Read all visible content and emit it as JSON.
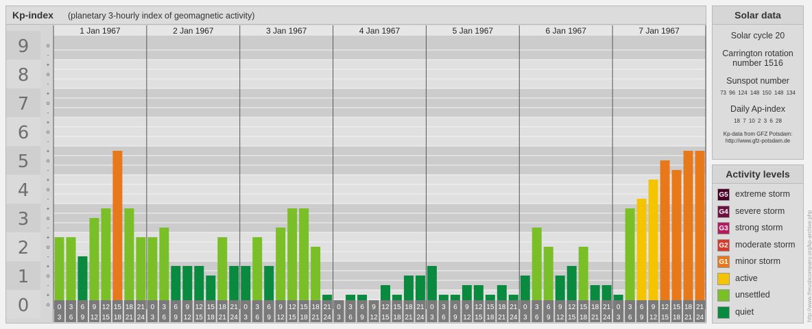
{
  "header": {
    "title": "Kp-index",
    "subtitle": "(planetary 3-hourly index of geomagnetic activity)"
  },
  "chart_data": {
    "type": "bar",
    "title": "Kp-index",
    "subtitle": "(planetary 3-hourly index of geomagnetic activity)",
    "ylim": [
      0,
      9
    ],
    "y_ticks": [
      "0",
      "1",
      "2",
      "3",
      "4",
      "5",
      "6",
      "7",
      "8",
      "9"
    ],
    "minor_ticks": [
      "o",
      "+",
      "-"
    ],
    "days": [
      "1 Jan 1967",
      "2 Jan 1967",
      "3 Jan 1967",
      "4 Jan 1967",
      "5 Jan 1967",
      "6 Jan 1967",
      "7 Jan 1967"
    ],
    "interval_labels": [
      [
        "0",
        "3"
      ],
      [
        "3",
        "6"
      ],
      [
        "6",
        "9"
      ],
      [
        "9",
        "12"
      ],
      [
        "12",
        "15"
      ],
      [
        "15",
        "18"
      ],
      [
        "18",
        "21"
      ],
      [
        "21",
        "24"
      ]
    ],
    "values": [
      [
        2.333,
        2.333,
        1.667,
        3.0,
        3.333,
        5.333,
        3.333,
        2.333
      ],
      [
        2.333,
        2.667,
        1.333,
        1.333,
        1.333,
        1.0,
        2.333,
        1.333
      ],
      [
        1.333,
        2.333,
        1.333,
        2.667,
        3.333,
        3.333,
        2.0,
        0.333
      ],
      [
        0.0,
        0.333,
        0.333,
        0.0,
        0.667,
        0.333,
        1.0,
        1.0
      ],
      [
        1.333,
        0.333,
        0.333,
        0.667,
        0.667,
        0.333,
        0.667,
        0.333
      ],
      [
        1.0,
        2.667,
        2.0,
        1.0,
        1.333,
        2.0,
        0.667,
        0.667
      ],
      [
        0.333,
        3.333,
        3.667,
        4.333,
        5.0,
        4.667,
        5.333,
        5.333
      ]
    ],
    "colors": {
      "quiet": "#0a8a3e",
      "unsettled": "#7bbf28",
      "active": "#f5c400",
      "minor_storm": "#e8791a",
      "moderate_storm": "#d63a2a",
      "strong_storm": "#b51a5c",
      "severe_storm": "#6e1040",
      "extreme_storm": "#4a0024"
    },
    "grid": true
  },
  "solar": {
    "title": "Solar data",
    "cycle": "Solar cycle 20",
    "carrington": "Carrington rotation number 1516",
    "sunspot_label": "Sunspot number",
    "sunspot_values": "73  96  124  148  150  148  134",
    "ap_label": "Daily Ap-index",
    "ap_values": "18  7  10  2  3  6  28",
    "credit_line1": "Kp-data from GFZ Potsdam:",
    "credit_line2": "http://www.gfz-potsdam.de"
  },
  "activity": {
    "title": "Activity levels",
    "levels": [
      {
        "code": "G5",
        "label": "extreme storm",
        "color": "#4a0024"
      },
      {
        "code": "G4",
        "label": "severe storm",
        "color": "#6e1040"
      },
      {
        "code": "G3",
        "label": "strong storm",
        "color": "#b51a5c"
      },
      {
        "code": "G2",
        "label": "moderate storm",
        "color": "#d63a2a"
      },
      {
        "code": "G1",
        "label": "minor storm",
        "color": "#e8791a"
      },
      {
        "code": "",
        "label": "active",
        "color": "#f5c400"
      },
      {
        "code": "",
        "label": "unsettled",
        "color": "#7bbf28"
      },
      {
        "code": "",
        "label": "quiet",
        "color": "#0a8a3e"
      }
    ]
  },
  "watermark": "http://www.theusbcompany.org/kp-archive.php"
}
